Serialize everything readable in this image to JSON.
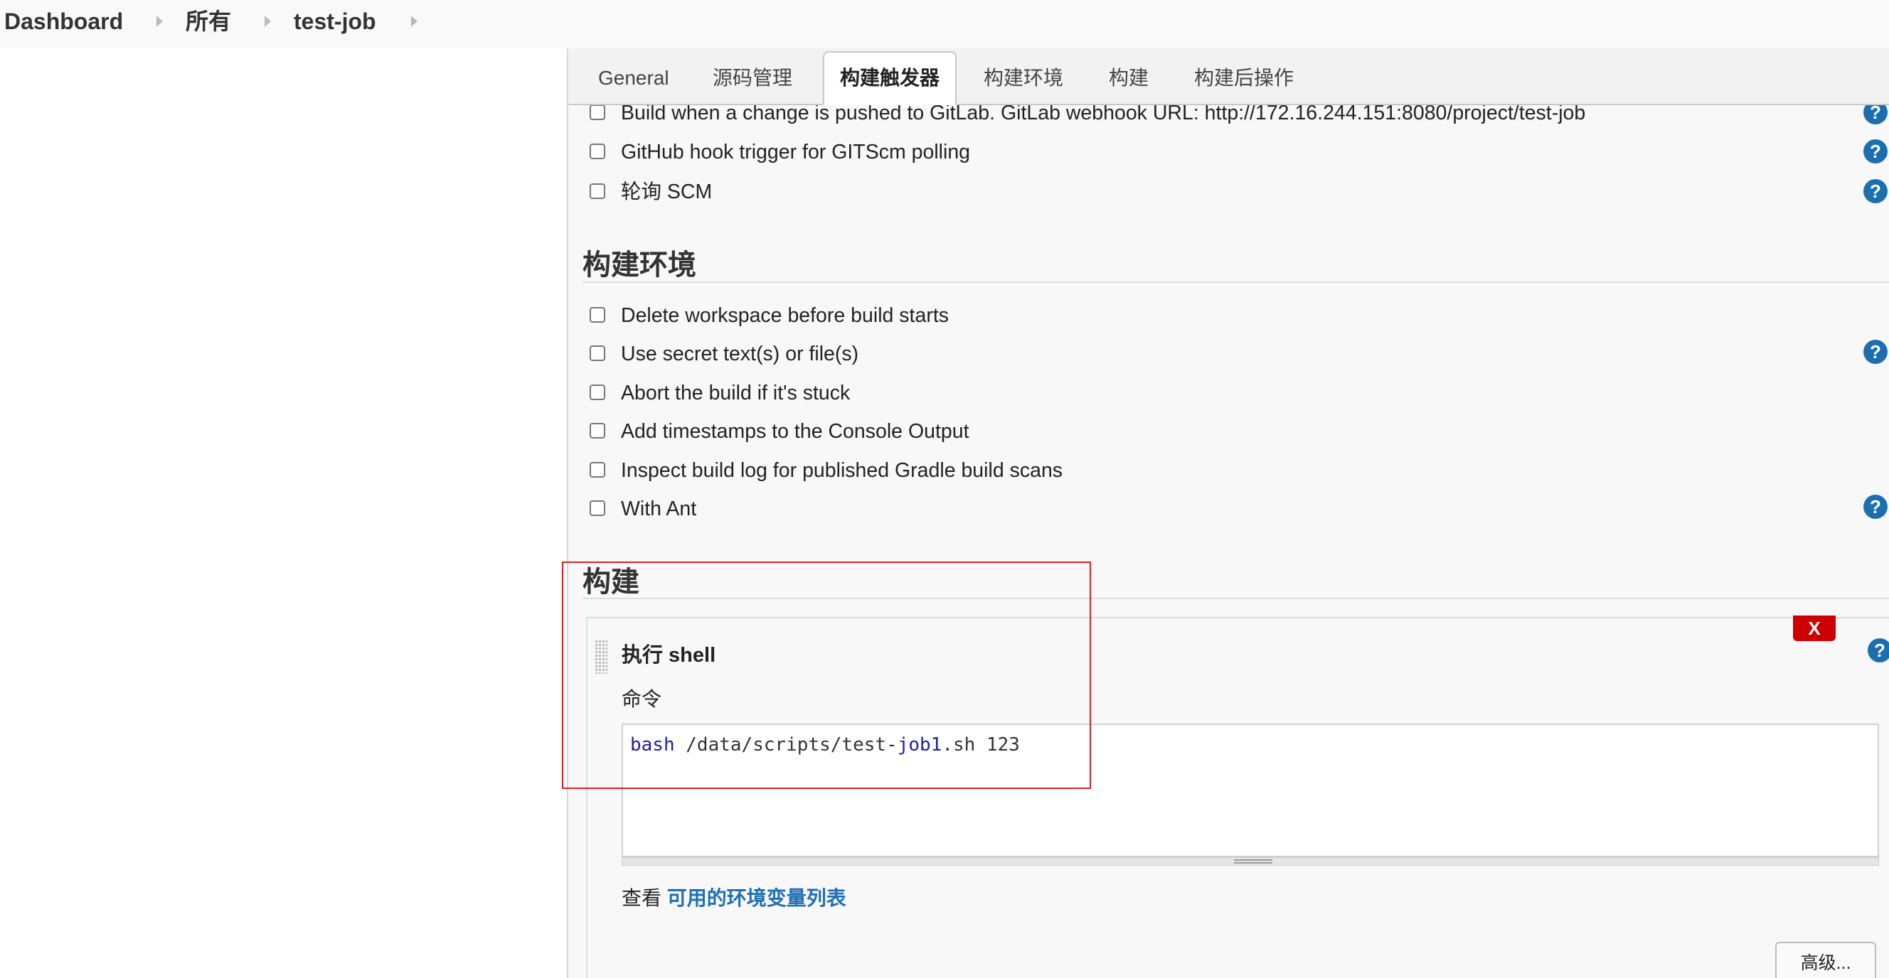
{
  "breadcrumb": {
    "items": [
      "Dashboard",
      "所有",
      "test-job"
    ]
  },
  "tabs": {
    "items": [
      "General",
      "源码管理",
      "构建触发器",
      "构建环境",
      "构建",
      "构建后操作"
    ],
    "active": "构建触发器"
  },
  "triggers": {
    "items": [
      "Build when a change is pushed to GitLab. GitLab webhook URL: http://172.16.244.151:8080/project/test-job",
      "GitHub hook trigger for GITScm polling",
      "轮询 SCM"
    ]
  },
  "build_env": {
    "title": "构建环境",
    "items": [
      "Delete workspace before build starts",
      "Use secret text(s) or file(s)",
      "Abort the build if it's stuck",
      "Add timestamps to the Console Output",
      "Inspect build log for published Gradle build scans",
      "With Ant"
    ]
  },
  "build": {
    "title": "构建",
    "step": {
      "title": "执行 shell",
      "delete_label": "X",
      "command_label": "命令",
      "code": {
        "kw1": "bash",
        "part1": " /data/scripts/test",
        "kw2": "-job1",
        "part2": ".sh 123"
      },
      "env_prefix": "查看 ",
      "env_link": "可用的环境变量列表",
      "advanced_label": "高级..."
    }
  },
  "help_label": "?",
  "colors": {
    "accent_help": "#1b6fae",
    "delete_red": "#cc0000",
    "link_blue": "#1e6fb6",
    "highlight_red": "#e02020"
  }
}
